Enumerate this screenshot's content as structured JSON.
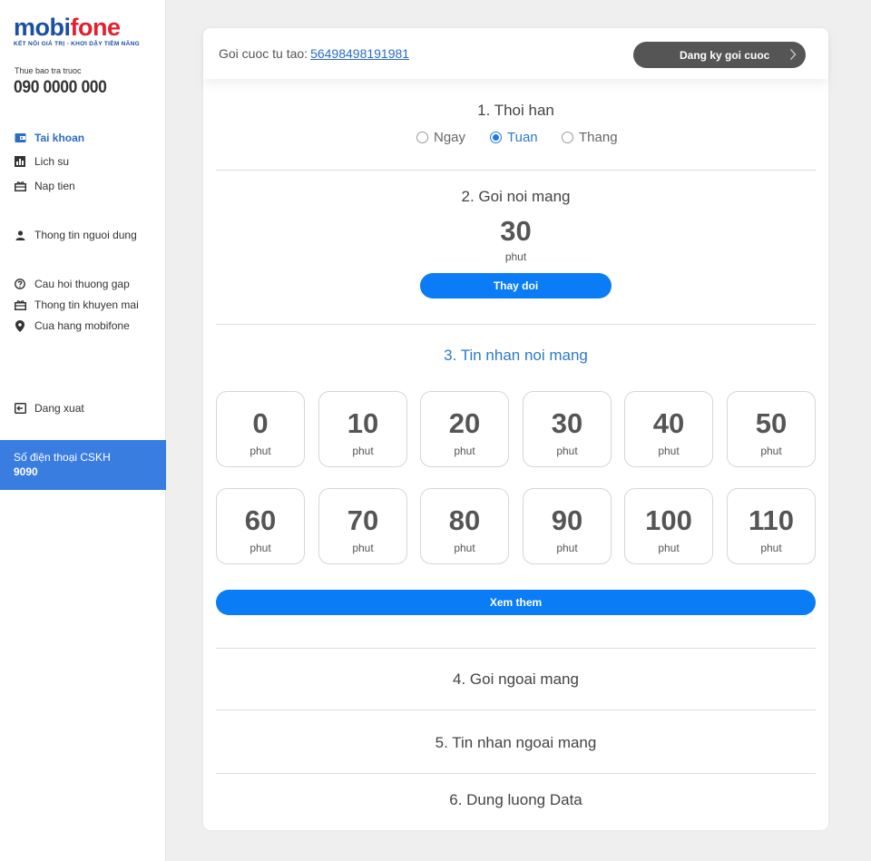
{
  "sidebar": {
    "logo_text_1": "mobi",
    "logo_text_2": "fone",
    "logo_tagline": "KẾT NỐI GIÁ TRỊ - KHƠI DẬY TIỀM NĂNG",
    "subscriber_label": "Thue bao tra truoc",
    "subscriber_number": "090 0000 000",
    "items": [
      {
        "label": "Tai khoan",
        "icon": "wallet-icon",
        "active": true
      },
      {
        "label": "Lich su",
        "icon": "bar-chart-icon"
      },
      {
        "label": "Nap tien",
        "icon": "gift-icon"
      },
      {
        "label": "Thong tin nguoi dung",
        "icon": "user-icon"
      },
      {
        "label": "Cau hoi thuong gap",
        "icon": "help-circle-icon"
      },
      {
        "label": "Thong tin khuyen mai",
        "icon": "gift-icon"
      },
      {
        "label": "Cua hang mobifone",
        "icon": "map-pin-icon"
      },
      {
        "label": "Dang xuat",
        "icon": "logout-icon"
      }
    ],
    "cskh_label": "Số điện thoại CSKH",
    "cskh_number": "9090"
  },
  "header": {
    "label": "Goi cuoc tu tao:",
    "code": "56498498191981",
    "register_button": "Dang ky goi cuoc"
  },
  "sections": {
    "duration": {
      "title": "1. Thoi han",
      "options": [
        "Ngay",
        "Tuan",
        "Thang"
      ],
      "selected": "Tuan"
    },
    "on_net_call": {
      "title": "2. Goi noi mang",
      "value": "30",
      "unit": "phut",
      "change_button": "Thay doi"
    },
    "on_net_sms": {
      "title": "3. Tin nhan noi mang",
      "options": [
        {
          "value": "0",
          "unit": "phut"
        },
        {
          "value": "10",
          "unit": "phut"
        },
        {
          "value": "20",
          "unit": "phut"
        },
        {
          "value": "30",
          "unit": "phut"
        },
        {
          "value": "40",
          "unit": "phut"
        },
        {
          "value": "50",
          "unit": "phut"
        },
        {
          "value": "60",
          "unit": "phut"
        },
        {
          "value": "70",
          "unit": "phut"
        },
        {
          "value": "80",
          "unit": "phut"
        },
        {
          "value": "90",
          "unit": "phut"
        },
        {
          "value": "100",
          "unit": "phut"
        },
        {
          "value": "110",
          "unit": "phut"
        }
      ],
      "more_button": "Xem them"
    },
    "off_net_call": {
      "title": "4. Goi ngoai mang"
    },
    "off_net_sms": {
      "title": "5. Tin nhan ngoai mang"
    },
    "data": {
      "title": "6. Dung luong Data"
    }
  },
  "colors": {
    "primary_blue": "#0a7cf5",
    "link_blue": "#2b6cc4",
    "cskh_blue": "#3a7de0",
    "dark_button": "#555555"
  }
}
